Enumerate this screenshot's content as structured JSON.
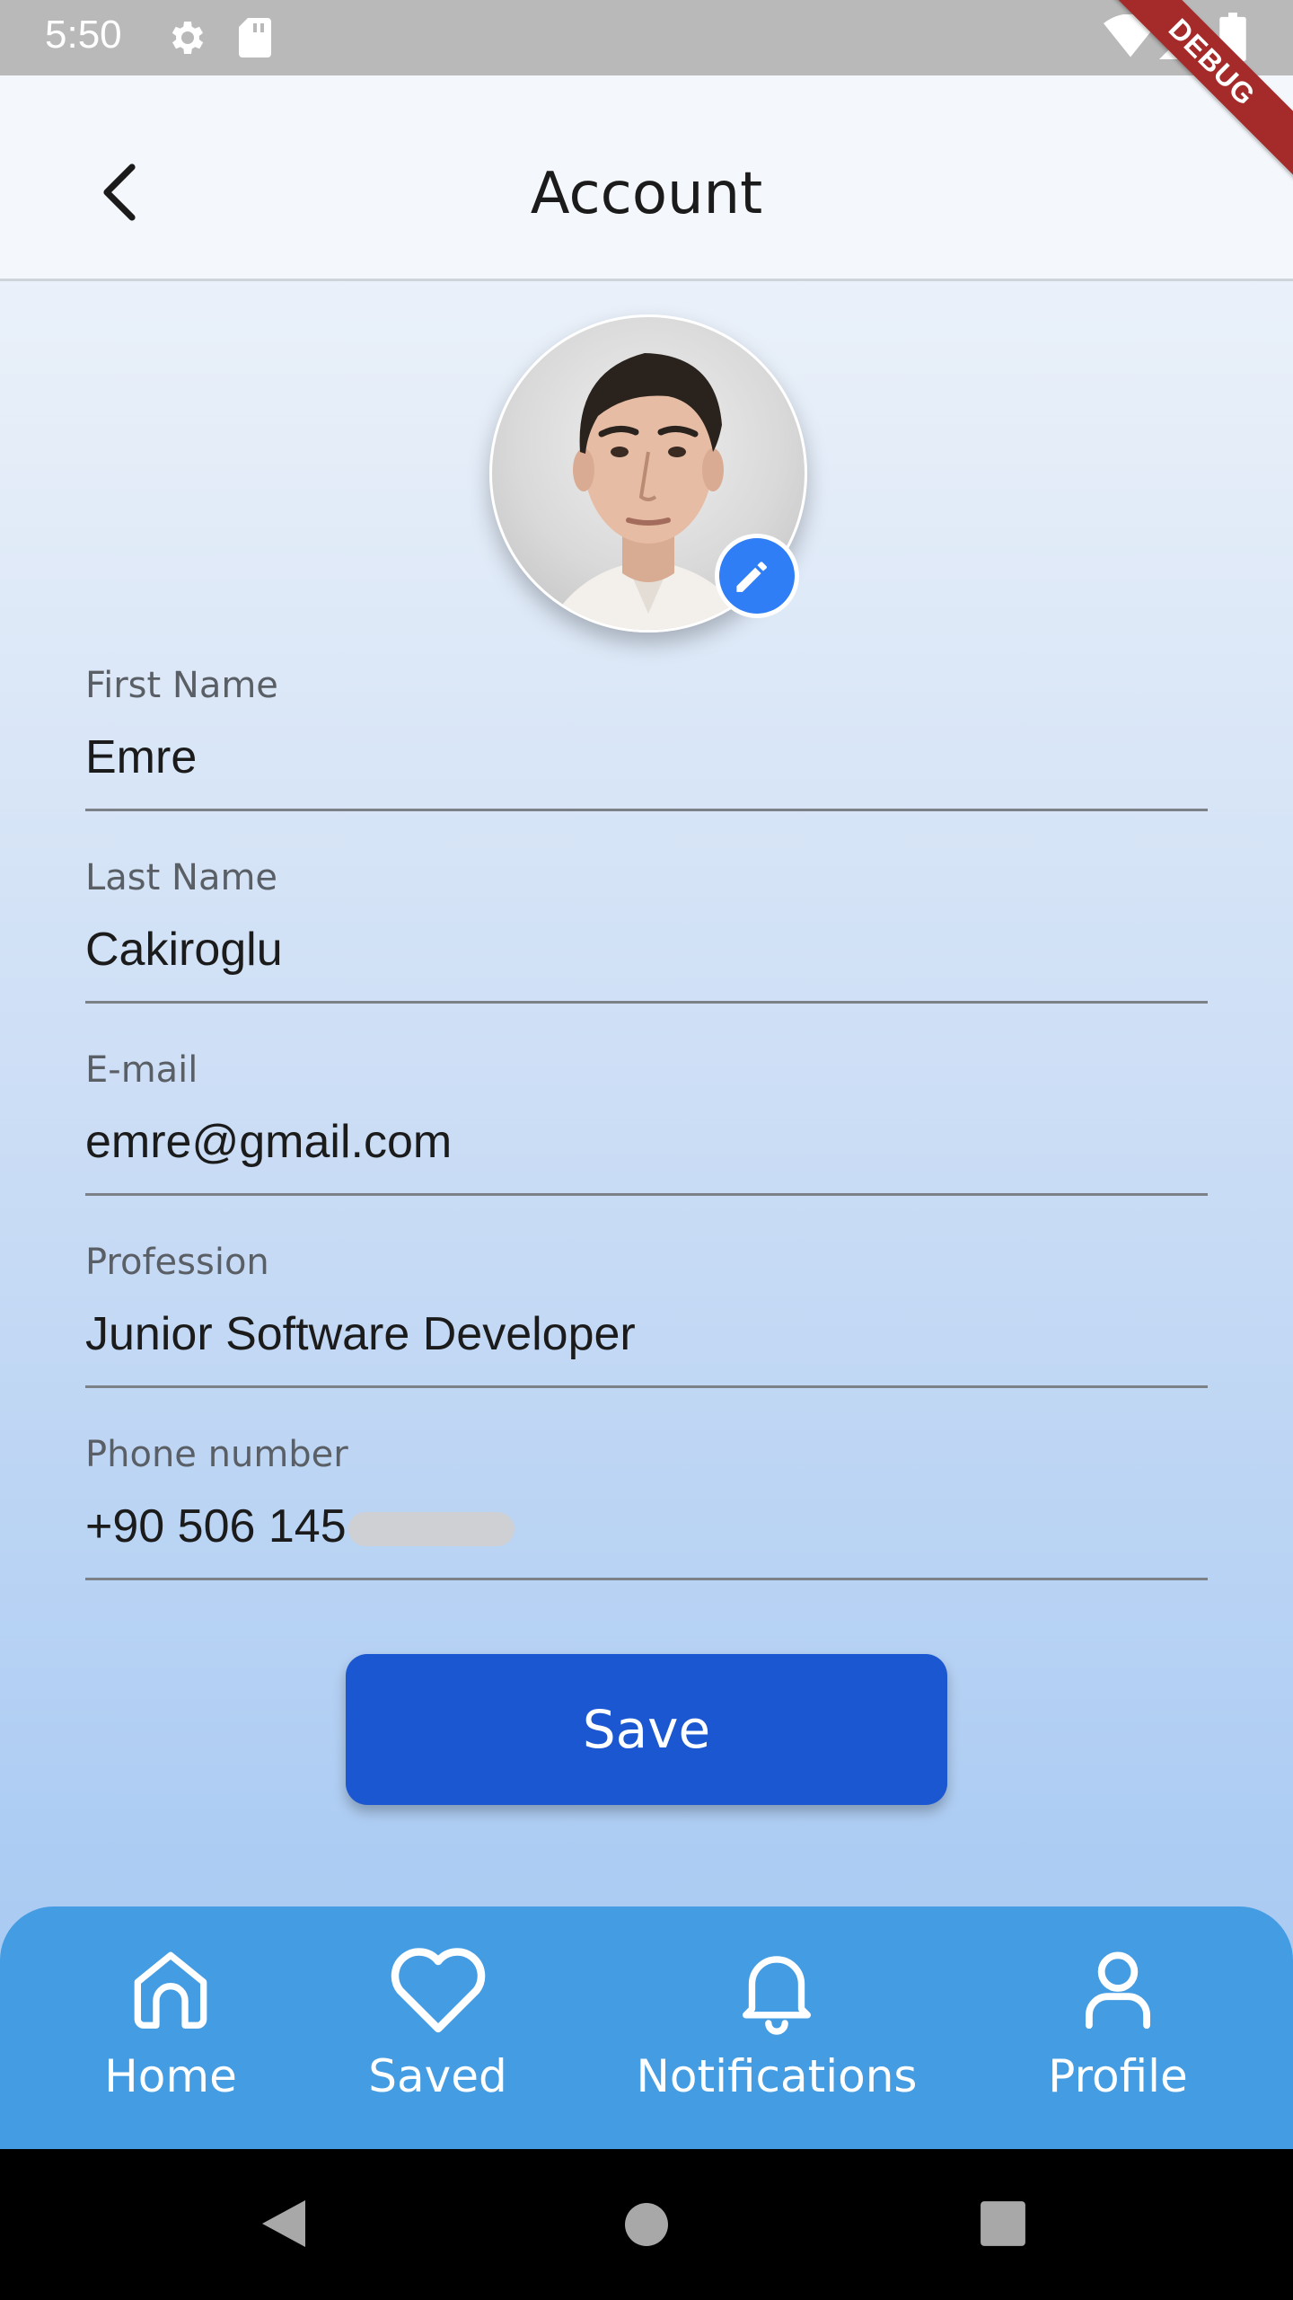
{
  "status_bar": {
    "time": "5:50",
    "icons": [
      "settings-gear-icon",
      "sd-card-icon",
      "wifi-icon",
      "cell-signal-icon",
      "battery-icon"
    ]
  },
  "debug_banner": "DEBUG",
  "app_bar": {
    "title": "Account",
    "back_icon": "chevron-left-icon"
  },
  "profile": {
    "avatar_icon": "profile-photo",
    "edit_icon": "pencil-icon"
  },
  "form": {
    "first_name": {
      "label": "First Name",
      "value": "Emre"
    },
    "last_name": {
      "label": "Last Name",
      "value": "Cakiroglu"
    },
    "email": {
      "label": "E-mail",
      "value": "emre@gmail.com"
    },
    "profession": {
      "label": "Profession",
      "value": "Junior Software Developer"
    },
    "phone": {
      "label": "Phone number",
      "value": "+90 506 145"
    }
  },
  "save_button": {
    "label": "Save"
  },
  "bottom_nav": {
    "items": [
      {
        "label": "Home",
        "icon": "home-icon"
      },
      {
        "label": "Saved",
        "icon": "heart-icon"
      },
      {
        "label": "Notifications",
        "icon": "bell-icon"
      },
      {
        "label": "Profile",
        "icon": "person-icon"
      }
    ]
  },
  "colors": {
    "primary_button": "#1b57d1",
    "bottom_nav": "#449ce3",
    "edit_badge": "#2f7ef5",
    "debug_ribbon": "#a52a2a"
  }
}
